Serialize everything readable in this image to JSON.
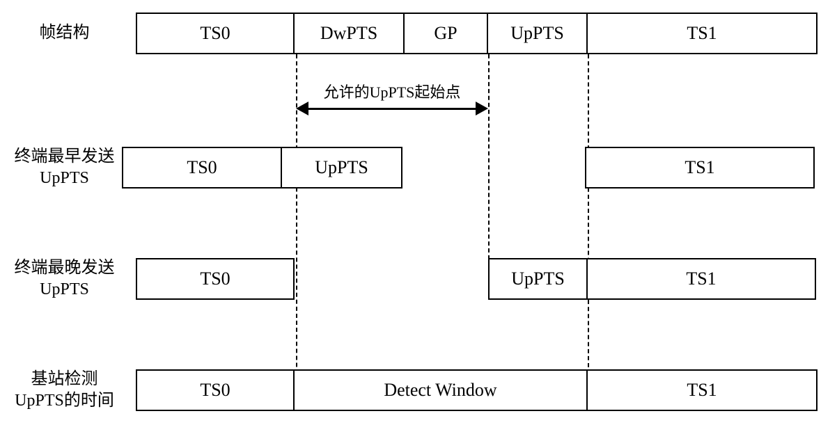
{
  "labels": {
    "frame_structure": "帧结构",
    "earliest_send": "终端最早发送\nUpPTS",
    "latest_send": "终端最晚发送\nUpPTS",
    "detect_time": "基站检测\nUpPTS的时间"
  },
  "blocks": {
    "ts0": "TS0",
    "dwpts": "DwPTS",
    "gp": "GP",
    "uppts": "UpPTS",
    "ts1": "TS1",
    "detect_window": "Detect Window"
  },
  "annotation": "允许的UpPTS起始点"
}
